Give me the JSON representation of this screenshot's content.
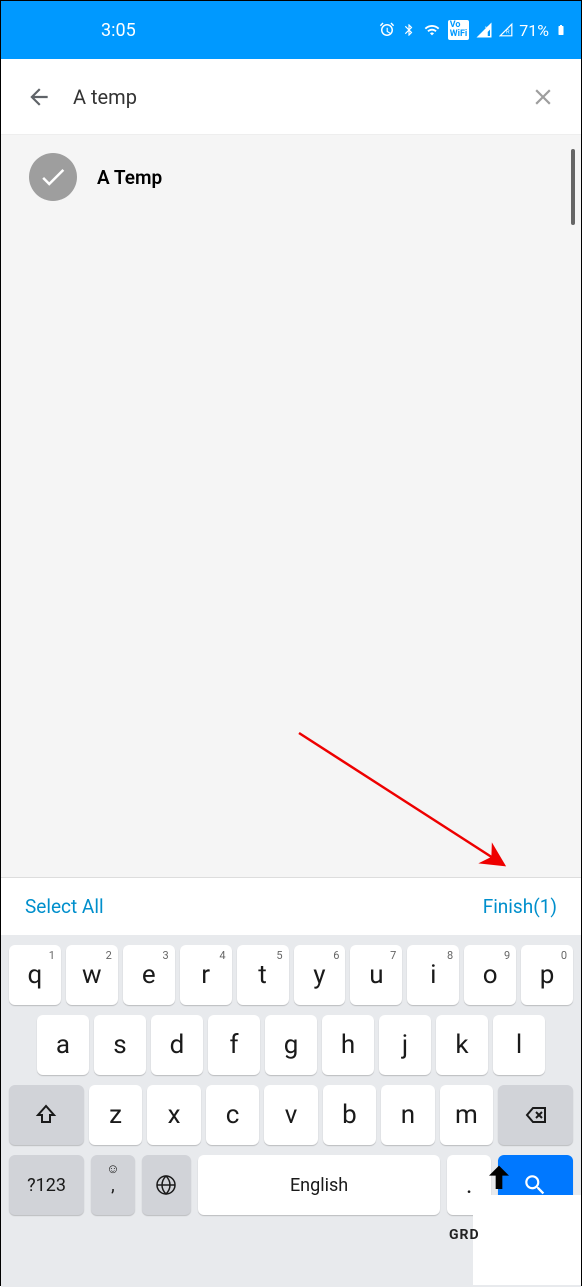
{
  "status": {
    "time": "3:05",
    "battery": "71%"
  },
  "search": {
    "value": "A temp"
  },
  "results": [
    {
      "label": "A Temp",
      "selected": true
    }
  ],
  "actions": {
    "select_all": "Select All",
    "finish": "Finish(1)"
  },
  "keyboard": {
    "row1": [
      {
        "k": "q",
        "n": "1"
      },
      {
        "k": "w",
        "n": "2"
      },
      {
        "k": "e",
        "n": "3"
      },
      {
        "k": "r",
        "n": "4"
      },
      {
        "k": "t",
        "n": "5"
      },
      {
        "k": "y",
        "n": "6"
      },
      {
        "k": "u",
        "n": "7"
      },
      {
        "k": "i",
        "n": "8"
      },
      {
        "k": "o",
        "n": "9"
      },
      {
        "k": "p",
        "n": "0"
      }
    ],
    "row2": [
      "a",
      "s",
      "d",
      "f",
      "g",
      "h",
      "j",
      "k",
      "l"
    ],
    "row3": [
      "z",
      "x",
      "c",
      "v",
      "b",
      "n",
      "m"
    ],
    "symbols": "?123",
    "comma": ",",
    "space": "English",
    "period": "."
  },
  "watermark": "GRD"
}
